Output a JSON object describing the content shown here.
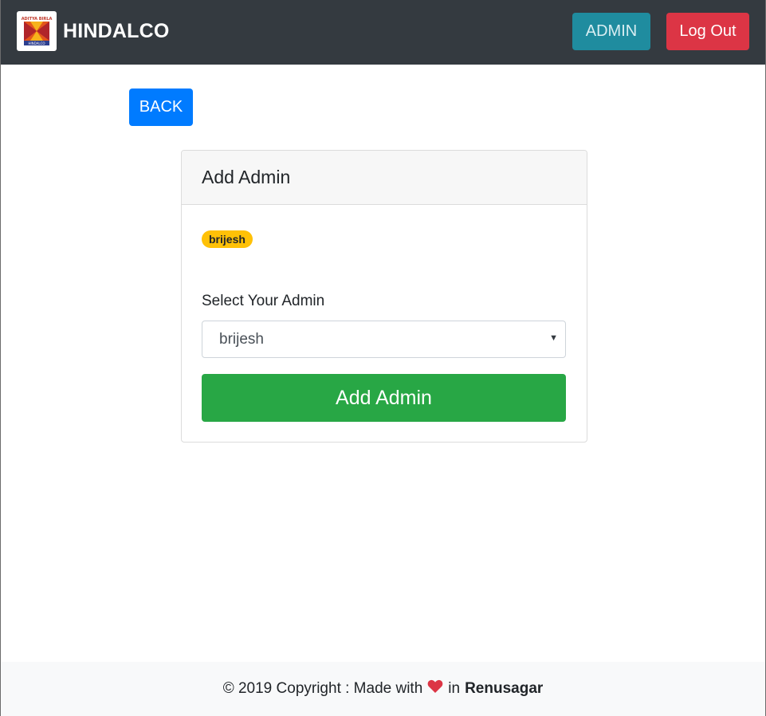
{
  "navbar": {
    "brand": "HINDALCO",
    "logo_text_top": "ADITYA BIRLA",
    "logo_text_bottom": "HINDALCO",
    "admin_label": "ADMIN",
    "logout_label": "Log Out"
  },
  "back_label": "BACK",
  "card": {
    "title": "Add Admin",
    "badge": "brijesh",
    "select_label": "Select Your Admin",
    "select_value": "brijesh",
    "submit_label": "Add Admin"
  },
  "footer": {
    "prefix": "© 2019 Copyright : Made with",
    "middle": "in",
    "place": "Renusagar"
  },
  "colors": {
    "navbar": "#343a40",
    "admin": "#17a2b8",
    "logout": "#dc3545",
    "back": "#007bff",
    "badge": "#ffc107",
    "submit": "#28a745",
    "heart": "#dc3545"
  },
  "icons": {
    "logo": "aditya-birla-logo-icon",
    "heart": "heart-icon",
    "caret": "chevron-down-icon"
  }
}
